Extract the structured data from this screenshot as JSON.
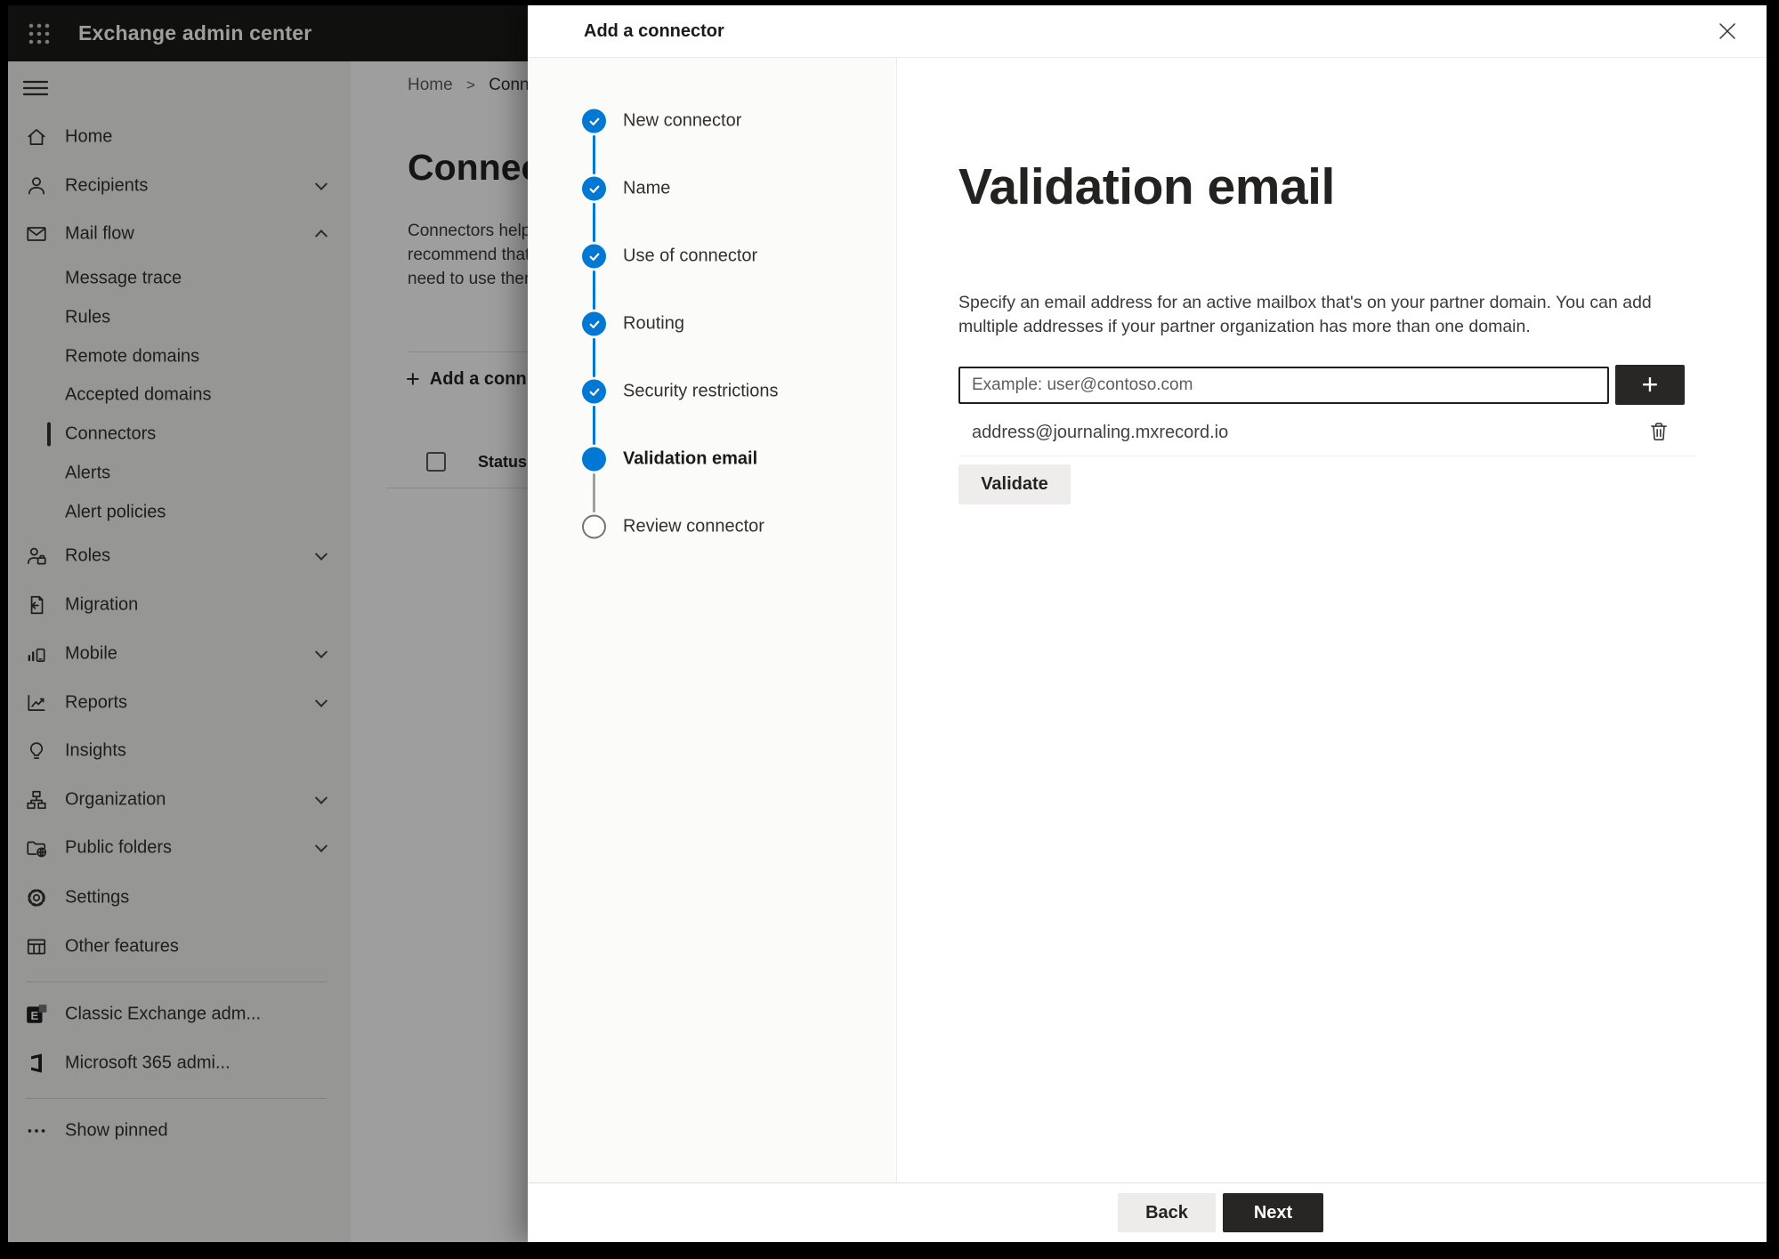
{
  "topbar": {
    "title": "Exchange admin center",
    "app_launcher_icon": "waffle-icon"
  },
  "sidebar": {
    "menu_icon": "hamburger-icon",
    "top_items": [
      {
        "label": "Home",
        "icon": "home-icon",
        "chevron": null
      },
      {
        "label": "Recipients",
        "icon": "person-icon",
        "chevron": "down"
      },
      {
        "label": "Mail flow",
        "icon": "mail-icon",
        "chevron": "up"
      }
    ],
    "mailflow_subitems": [
      "Message trace",
      "Rules",
      "Remote domains",
      "Accepted domains",
      "Connectors",
      "Alerts",
      "Alert policies"
    ],
    "selected_subitem": "Connectors",
    "lower_items": [
      {
        "label": "Roles",
        "icon": "roles-icon",
        "chevron": "down"
      },
      {
        "label": "Migration",
        "icon": "migration-icon",
        "chevron": null
      },
      {
        "label": "Mobile",
        "icon": "mobile-icon",
        "chevron": "down"
      },
      {
        "label": "Reports",
        "icon": "reports-icon",
        "chevron": "down"
      },
      {
        "label": "Insights",
        "icon": "insights-icon",
        "chevron": null
      },
      {
        "label": "Organization",
        "icon": "organization-icon",
        "chevron": "down"
      },
      {
        "label": "Public folders",
        "icon": "public-folders-icon",
        "chevron": "down"
      },
      {
        "label": "Settings",
        "icon": "settings-icon",
        "chevron": null
      },
      {
        "label": "Other features",
        "icon": "other-features-icon",
        "chevron": null
      }
    ],
    "footer_items": [
      {
        "label": "Classic Exchange adm...",
        "icon": "classic-exchange-icon"
      },
      {
        "label": "Microsoft 365 admi...",
        "icon": "microsoft-365-icon"
      },
      {
        "label": "Show pinned",
        "icon": "ellipsis-icon"
      }
    ]
  },
  "background_page": {
    "breadcrumb": {
      "home": "Home",
      "separator": ">",
      "current": "Conne"
    },
    "page_title": "Connect",
    "intro_lines": [
      "Connectors help",
      "recommend that",
      "need to use ther"
    ],
    "add_connector_button": "Add a conn",
    "add_connector_plus": "+",
    "table": {
      "status_header": "Status"
    }
  },
  "panel": {
    "title": "Add a connector",
    "close_icon": "close-icon",
    "steps": [
      {
        "label": "New connector",
        "state": "completed"
      },
      {
        "label": "Name",
        "state": "completed"
      },
      {
        "label": "Use of connector",
        "state": "completed"
      },
      {
        "label": "Routing",
        "state": "completed"
      },
      {
        "label": "Security restrictions",
        "state": "completed"
      },
      {
        "label": "Validation email",
        "state": "current"
      },
      {
        "label": "Review connector",
        "state": "upcoming"
      }
    ],
    "content": {
      "heading": "Validation email",
      "description_lines": [
        "Specify an email address for an active mailbox that's on your partner domain. You can add",
        "multiple addresses if your partner organization has more than one domain."
      ],
      "email_input": {
        "value": "",
        "placeholder": "Example: user@contoso.com"
      },
      "add_email_button": "+",
      "email_list": [
        {
          "address": "address@journaling.mxrecord.io",
          "action_icon": "trash-icon"
        }
      ],
      "validate_button": "Validate"
    },
    "footer": {
      "back_button": "Back",
      "next_button": "Next"
    }
  },
  "colors": {
    "accent_blue": "#0078d4",
    "topbar_bg": "#1b1a19",
    "sidebar_bg": "#f3f2f1",
    "overlay": "rgba(0,0,0,0.38)",
    "dark_button": "#282726",
    "light_button": "#efedeb"
  }
}
